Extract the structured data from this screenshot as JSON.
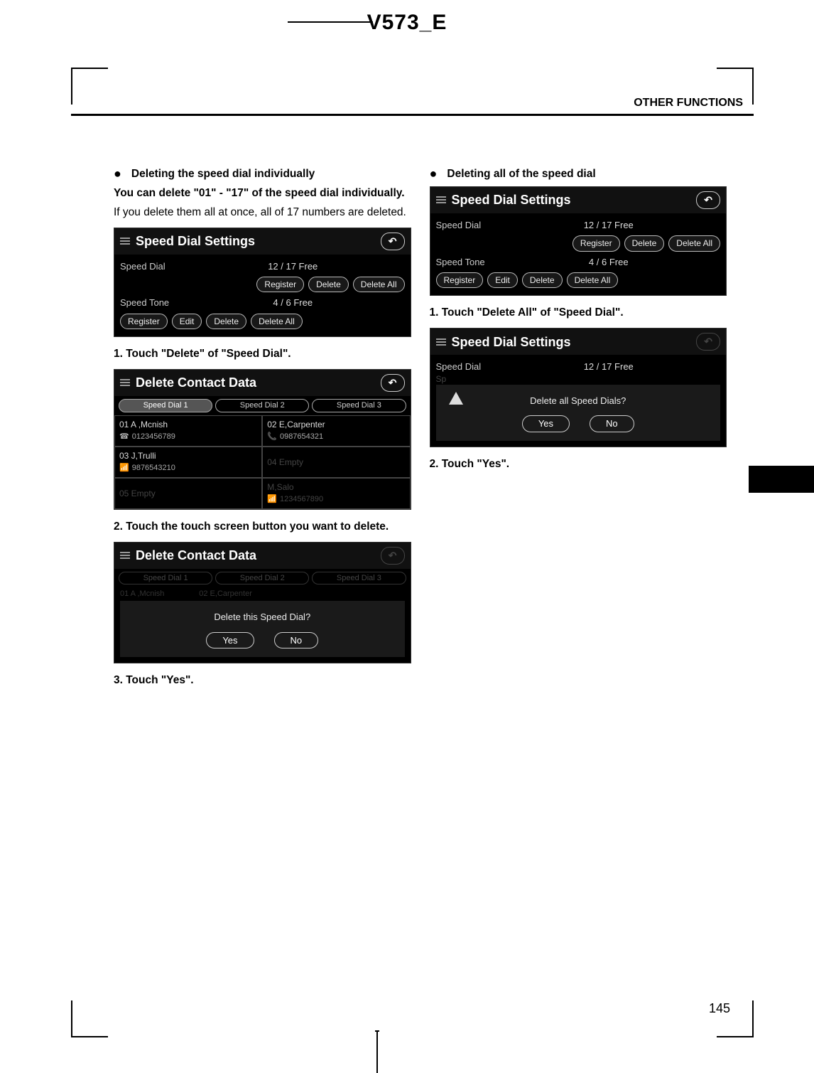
{
  "doc_header": "V573_E",
  "section_header": "OTHER FUNCTIONS",
  "page_number": "145",
  "left": {
    "bullet_title": "Deleting the speed dial individually",
    "intro_bold": "You can delete \"01\" - \"17\" of the speed dial individually.",
    "intro_reg": "If you delete them all at once, all of 17 numbers are deleted.",
    "step1": "1.  Touch \"Delete\" of \"Speed Dial\".",
    "step2": "2. Touch the touch screen button you want to delete.",
    "step3": "3.  Touch \"Yes\"."
  },
  "right": {
    "bullet_title": "Deleting all of the speed dial",
    "step1": "1. Touch \"Delete All\" of \"Speed Dial\".",
    "step2": "2.  Touch \"Yes\"."
  },
  "settings_panel": {
    "title": "Speed Dial Settings",
    "row1_label": "Speed Dial",
    "row1_info": "12 / 17  Free",
    "row1_btn1": "Register",
    "row1_btn2": "Delete",
    "row1_btn3": "Delete All",
    "row2_label": "Speed Tone",
    "row2_info": "4 / 6  Free",
    "row2_btn0": "Register",
    "row2_btn1": "Edit",
    "row2_btn2": "Delete",
    "row2_btn3": "Delete All"
  },
  "delete_panel": {
    "title": "Delete Contact Data",
    "tab1": "Speed Dial 1",
    "tab2": "Speed Dial 2",
    "tab3": "Speed Dial 3",
    "c01": "01  A ,Mcnish",
    "c01p": "0123456789",
    "c02": "02  E,Carpenter",
    "c02p": "0987654321",
    "c03": "03  J,Trulli",
    "c03p": "9876543210",
    "c04": "04  Empty",
    "c05": "05  Empty",
    "c06": "M,Salo",
    "c06p": "1234567890"
  },
  "dialog1": {
    "text": "Delete this Speed Dial?",
    "yes": "Yes",
    "no": "No"
  },
  "dialog2": {
    "text": "Delete all Speed Dials?",
    "yes": "Yes",
    "no": "No"
  }
}
